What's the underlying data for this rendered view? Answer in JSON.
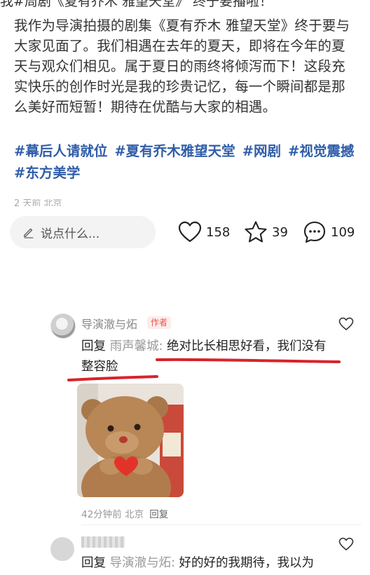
{
  "post": {
    "cut_line": "我#周剧《夏有乔木 雅望天堂》 终于要播啦！",
    "body": "我作为导演拍摄的剧集《夏有乔木 雅望天堂》终于要与大家见面了。我们相遇在去年的夏天，即将在今年的夏天与观众们相见。属于夏日的雨终将倾泻而下！这段充实快乐的创作时光是我的珍贵记忆，每一个瞬间都是那么美好而短暂！期待在优酷与大家的相遇。",
    "hashtags": [
      "#幕后人请就位",
      "#夏有乔木雅望天堂",
      "#网剧",
      "#视觉震撼",
      "#东方美学"
    ],
    "meta_cut": "2 天前 北京"
  },
  "actions": {
    "comment_placeholder": "说点什么...",
    "likes": "158",
    "stars": "39",
    "comments": "109"
  },
  "comments": [
    {
      "author": "导演澈与炻",
      "badge": "作者",
      "reply_prefix": "回复",
      "reply_to": "雨声馨城:",
      "text": " 绝对比长相思好看，我们没有整容脸",
      "time": "42分钟前",
      "location": "北京",
      "reply_label": "回复"
    },
    {
      "author": "",
      "reply_prefix": "回复",
      "reply_to": "导演澈与炻:",
      "text": " 好的好的我期待，我以为"
    }
  ],
  "colors": {
    "hashtag": "#2f5da8",
    "underline": "#d8232a",
    "badge": "#e0564a"
  },
  "icons": [
    "pen-icon",
    "heart-icon",
    "star-icon",
    "comment-bubble-icon"
  ]
}
